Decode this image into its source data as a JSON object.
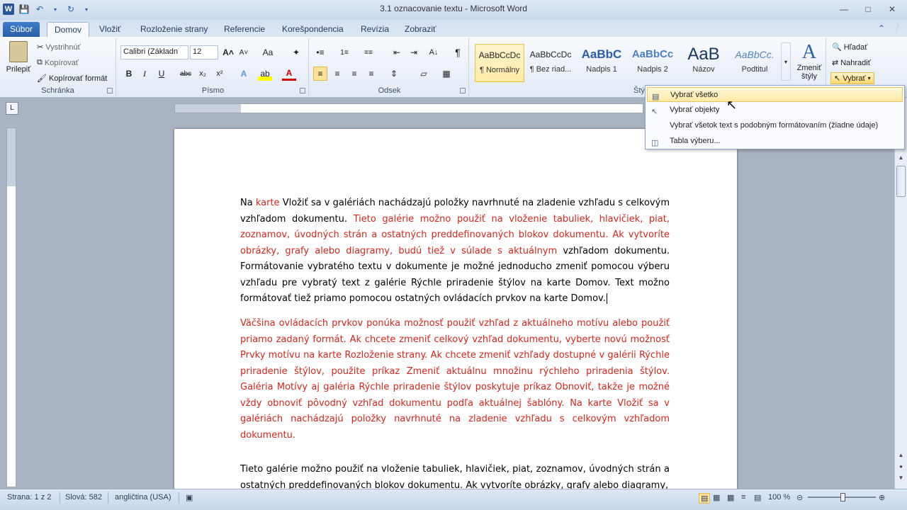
{
  "window": {
    "title": "3.1 oznacovanie textu - Microsoft Word",
    "app_icon": "W"
  },
  "tabs": {
    "file": "Súbor",
    "items": [
      "Domov",
      "Vložiť",
      "Rozloženie strany",
      "Referencie",
      "Korešpondencia",
      "Revízia",
      "Zobraziť"
    ]
  },
  "clipboard": {
    "paste": "Prilepiť",
    "cut": "Vystrihnúť",
    "copy": "Kopírovať",
    "format_painter": "Kopírovať formát",
    "label": "Schránka"
  },
  "font": {
    "name": "Calibri (Základn",
    "size": "12",
    "label": "Písmo"
  },
  "paragraph": {
    "label": "Odsek"
  },
  "styles": {
    "label": "Štýly",
    "items": [
      {
        "preview": "AaBbCcDc",
        "name": "¶ Normálny"
      },
      {
        "preview": "AaBbCcDc",
        "name": "¶ Bez riad..."
      },
      {
        "preview": "AaBbC",
        "name": "Nadpis 1"
      },
      {
        "preview": "AaBbCc",
        "name": "Nadpis 2"
      },
      {
        "preview": "AaB",
        "name": "Názov"
      },
      {
        "preview": "AaBbCc.",
        "name": "Podtitul"
      }
    ],
    "change": "Zmeniť štýly"
  },
  "editing": {
    "find": "Hľadať",
    "replace": "Nahradiť",
    "select": "Vybrať"
  },
  "select_menu": {
    "items": [
      "Vybrať všetko",
      "Vybrať objekty",
      "Vybrať všetok text s podobným formátovaním (žiadne údaje)",
      "Tabla výberu..."
    ]
  },
  "ruler": {
    "box": "L"
  },
  "document": {
    "p1_a": "Na ",
    "p1_b": "karte",
    "p1_c": " Vložiť sa v galériách nachádzajú položky navrhnuté na zladenie vzhľadu s celkovým vzhľadom dokumentu. ",
    "p1_d": "Tieto galérie možno použiť na vloženie tabuliek, hlavičiek, piat, zoznamov, úvodných strán a ostatných preddefinovaných blokov dokumentu. Ak vytvoríte obrázky, grafy alebo diagramy, budú tiež v súlade s aktuálnym",
    "p1_e": " vzhľadom dokumentu. Formátovanie vybratého textu v dokumente je možné jednoducho zmeniť pomocou výberu vzhľadu pre vybratý text z galérie Rýchle priradenie štýlov na karte Domov. Text možno formátovať tiež priamo pomocou ostatných ovládacích prvkov na karte Domov.",
    "p2": "Väčšina ovládacích prvkov ponúka možnosť použiť vzhľad z aktuálneho motívu alebo použiť priamo zadaný formát. Ak chcete zmeniť celkový vzhľad dokumentu, vyberte novú možnosť Prvky motívu na karte Rozloženie strany. Ak chcete zmeniť vzhľady dostupné v galérii Rýchle priradenie štýlov, použite príkaz Zmeniť aktuálnu množinu rýchleho priradenia štýlov. Galéria Motívy aj galéria Rýchle priradenie štýlov poskytuje príkaz Obnoviť, takže je možné vždy obnoviť pôvodný vzhľad dokumentu podľa aktuálnej šablóny. Na karte Vložiť sa v galériách nachádzajú položky navrhnuté na zladenie vzhľadu s celkovým vzhľadom dokumentu.",
    "p3": "Tieto galérie možno použiť na vloženie tabuliek, hlavičiek, piat, zoznamov, úvodných strán a ostatných preddefinovaných blokov dokumentu. Ak vytvoríte obrázky, grafy alebo diagramy,"
  },
  "status": {
    "page": "Strana: 1 z 2",
    "words": "Slová: 582",
    "language": "angličtina (USA)",
    "zoom": "100 %"
  },
  "colors": {
    "accent": "#2a5ea8",
    "red_text": "#d9251a"
  }
}
